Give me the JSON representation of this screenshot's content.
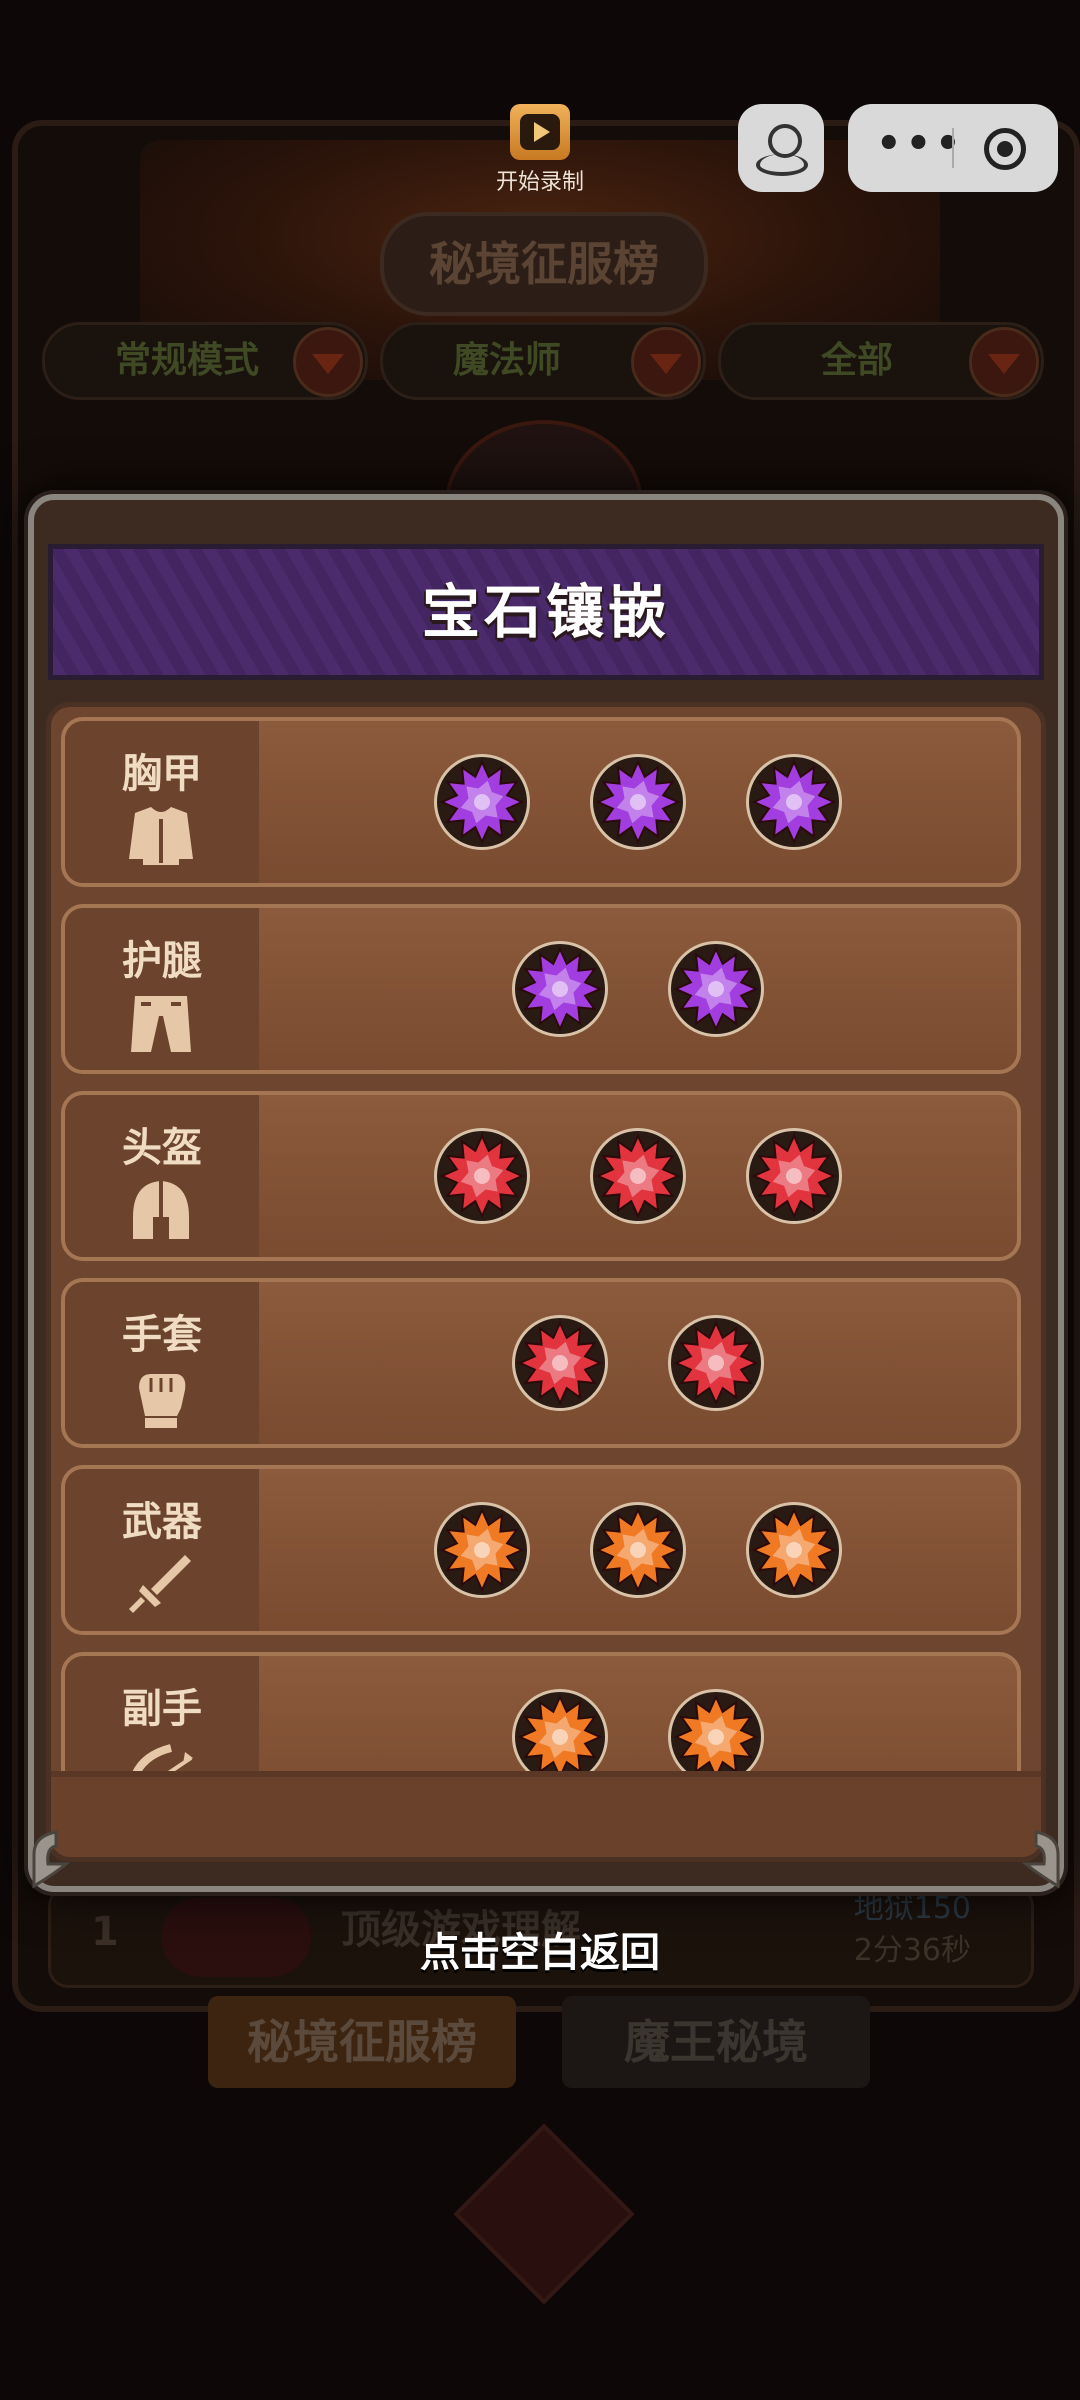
{
  "record": {
    "label": "开始录制"
  },
  "background": {
    "ranking_title": "秘境征服榜",
    "filters": [
      "常规模式",
      "魔法师",
      "全部"
    ],
    "rank_row": {
      "rank": "1",
      "name": "顶级游戏理解",
      "score": "地狱150",
      "time": "2分36秒"
    },
    "tabs": [
      "秘境征服榜",
      "魔王秘境"
    ]
  },
  "modal": {
    "title": "宝石镶嵌",
    "slots": [
      {
        "name": "胸甲",
        "icon": "chestplate-icon",
        "gem_color": "purple",
        "gem_count": 3
      },
      {
        "name": "护腿",
        "icon": "leggings-icon",
        "gem_color": "purple",
        "gem_count": 2
      },
      {
        "name": "头盔",
        "icon": "helmet-icon",
        "gem_color": "red",
        "gem_count": 3
      },
      {
        "name": "手套",
        "icon": "gauntlet-icon",
        "gem_color": "red",
        "gem_count": 2
      },
      {
        "name": "武器",
        "icon": "sword-icon",
        "gem_color": "orange",
        "gem_count": 3
      },
      {
        "name": "副手",
        "icon": "bow-icon",
        "gem_color": "orange",
        "gem_count": 2
      }
    ]
  },
  "hint": "点击空白返回",
  "colors": {
    "purple": "#a23ee0",
    "red": "#e2343f",
    "orange": "#f07a24",
    "header_purple": "#4b2b6c",
    "panel_brown": "#6e4630"
  }
}
